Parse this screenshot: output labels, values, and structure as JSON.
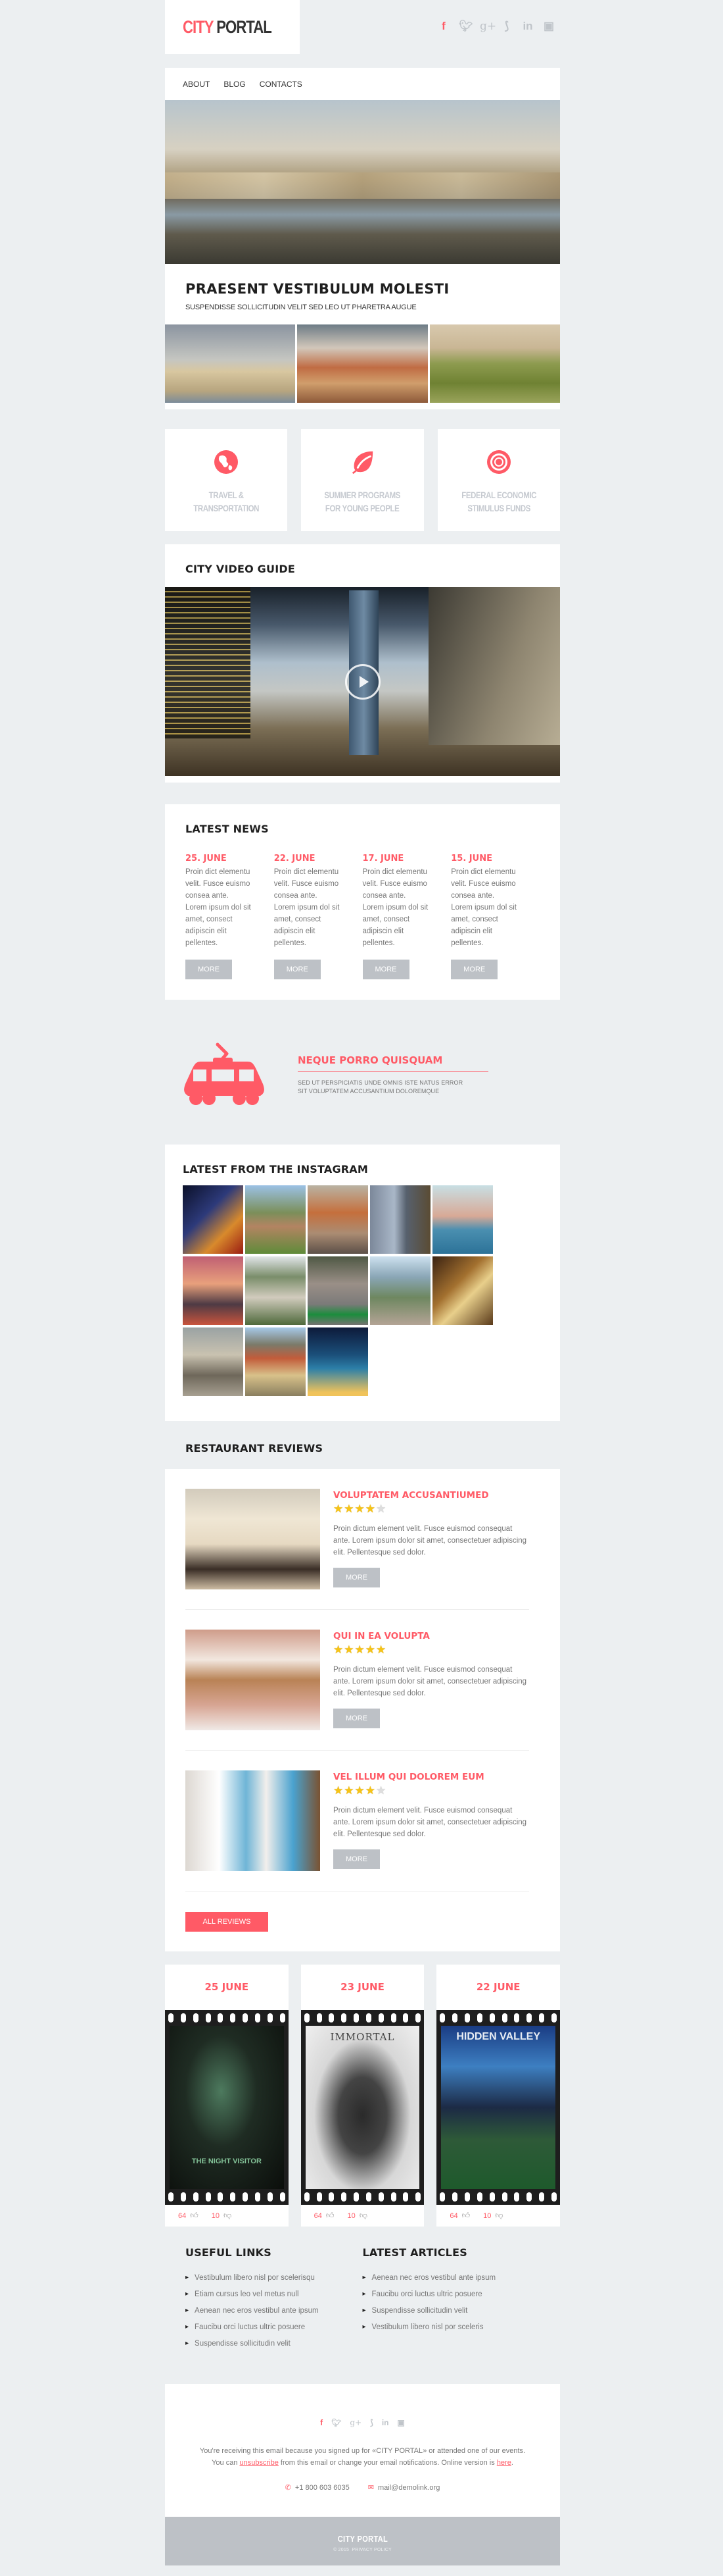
{
  "header": {
    "logo_part1": "CITY",
    "logo_part2": "PORTAL",
    "social_icons": [
      "facebook-icon",
      "twitter-icon",
      "google-plus-icon",
      "rss-icon",
      "linkedin-icon",
      "instagram-icon"
    ]
  },
  "nav": {
    "items": [
      "ABOUT",
      "BLOG",
      "CONTACTS"
    ]
  },
  "hero": {
    "title": "PRAESENT VESTIBULUM MOLESTI",
    "subtitle": "SUSPENDISSE SOLLICITUDIN VELIT SED LEO UT PHARETRA AUGUE"
  },
  "features": [
    {
      "icon": "globe-icon",
      "label_line1": "TRAVEL &",
      "label_line2": "TRANSPORTATION"
    },
    {
      "icon": "leaf-icon",
      "label_line1": "SUMMER PROGRAMS",
      "label_line2": "FOR YOUNG PEOPLE"
    },
    {
      "icon": "target-icon",
      "label_line1": "FEDERAL ECONOMIC",
      "label_line2": "STIMULUS FUNDS"
    }
  ],
  "video": {
    "title": "CITY VIDEO GUIDE"
  },
  "news": {
    "title": "LATEST NEWS",
    "items": [
      {
        "date": "25. JUNE",
        "text": "Proin dict elementu velit. Fusce euismo consea ante. Lorem ipsum dol sit amet, consect adipiscin elit pellentes.",
        "button": "MORE"
      },
      {
        "date": "22. JUNE",
        "text": "Proin dict elementu velit. Fusce euismo consea ante. Lorem ipsum dol sit amet, consect adipiscin elit pellentes.",
        "button": "MORE"
      },
      {
        "date": "17. JUNE",
        "text": "Proin dict elementu velit. Fusce euismo consea ante. Lorem ipsum dol sit amet, consect adipiscin elit pellentes.",
        "button": "MORE"
      },
      {
        "date": "15. JUNE",
        "text": "Proin dict elementu velit. Fusce euismo consea ante. Lorem ipsum dol sit amet, consect adipiscin elit pellentes.",
        "button": "MORE"
      }
    ]
  },
  "banner": {
    "title": "NEQUE PORRO QUISQUAM",
    "line1": "SED UT PERSPICIATIS UNDE OMNIS ISTE NATUS ERROR",
    "line2": "SIT VOLUPTATEM ACCUSANTIUM DOLOREMQUE"
  },
  "instagram": {
    "title": "LATEST FROM THE INSTAGRAM",
    "photo_count": 13
  },
  "restaurants": {
    "title": "RESTAURANT REVIEWS",
    "items": [
      {
        "name": "VOLUPTATEM ACCUSANTIUMED",
        "rating": 4,
        "max_rating": 5,
        "text": "Proin dictum element velit. Fusce euismod consequat ante. Lorem ipsum dolor sit amet, consectetuer adipiscing elit. Pellentesque sed dolor.",
        "button": "MORE"
      },
      {
        "name": "QUI IN EA VOLUPTA",
        "rating": 5,
        "max_rating": 5,
        "text": "Proin dictum element velit. Fusce euismod consequat ante. Lorem ipsum dolor sit amet, consectetuer adipiscing elit. Pellentesque sed dolor.",
        "button": "MORE"
      },
      {
        "name": "VEL ILLUM QUI DOLOREM EUM",
        "rating": 4,
        "max_rating": 5,
        "text": "Proin dictum element velit. Fusce euismod consequat ante. Lorem ipsum dolor sit amet, consectetuer adipiscing elit. Pellentesque sed dolor.",
        "button": "MORE"
      }
    ],
    "all_button": "ALL REVIEWS"
  },
  "movies": [
    {
      "date": "25 JUNE",
      "poster_title": "THE NIGHT VISITOR",
      "likes": "64",
      "dislikes": "10"
    },
    {
      "date": "23 JUNE",
      "poster_title": "IMMORTAL",
      "likes": "64",
      "dislikes": "10"
    },
    {
      "date": "22 JUNE",
      "poster_title": "HIDDEN VALLEY",
      "likes": "64",
      "dislikes": "10"
    }
  ],
  "links": {
    "useful_title": "USEFUL LINKS",
    "useful": [
      "Vestibulum libero nisl por scelerisqu",
      "Etiam cursus leo vel metus null",
      "Aenean nec eros vestibul ante ipsum",
      "Faucibu orci luctus ultric posuere",
      "Suspendisse sollicitudin velit"
    ],
    "articles_title": "LATEST ARTICLES",
    "articles": [
      "Aenean nec eros vestibul ante ipsum",
      "Faucibu orci luctus ultric posuere",
      "Suspendisse sollicitudin velit",
      "Vestibulum libero nisl por sceleris"
    ]
  },
  "footer": {
    "line1": "You're receiving this email because you signed up for «CITY PORTAL» or attended one of our events.",
    "line2_pre": "You can ",
    "unsubscribe": "unsubscribe",
    "line2_mid": " from this email or change your email notifications. Online version is ",
    "here": "here",
    "line2_end": ".",
    "phone": "+1 800 603 6035",
    "email": "mail@demolink.org",
    "brand": "CITY PORTAL",
    "copyright": "© 2015",
    "privacy": "PRIVACY POLICY"
  },
  "colors": {
    "accent": "#ff5a66",
    "background": "#eceff1",
    "button_gray": "#bdc1c6",
    "footer_bar": "#bdc1c6"
  }
}
